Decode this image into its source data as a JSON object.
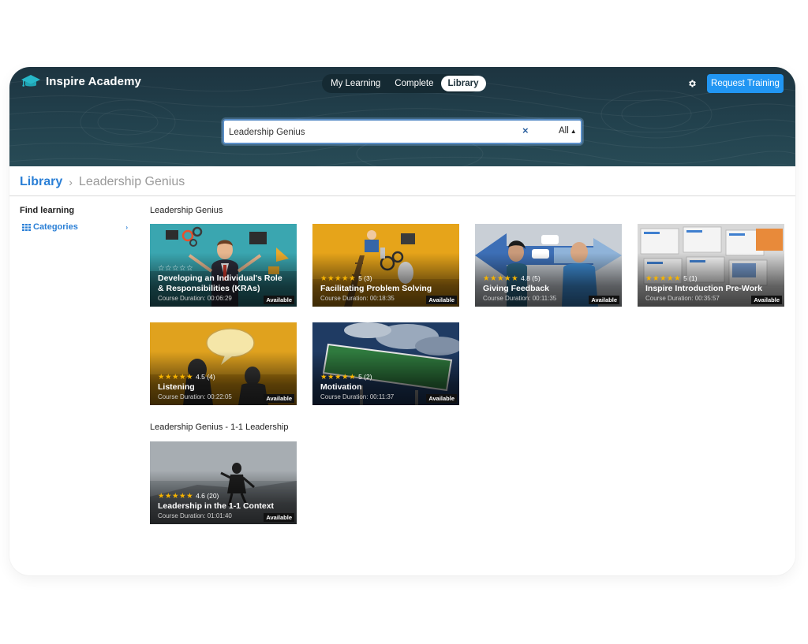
{
  "app": {
    "name": "Inspire Academy"
  },
  "nav": {
    "tabs": [
      {
        "label": "My Learning",
        "active": false
      },
      {
        "label": "Complete",
        "active": false
      },
      {
        "label": "Library",
        "active": true
      }
    ]
  },
  "header": {
    "settings_icon": "gear-icon",
    "request_label": "Request Training",
    "accent": "#2196f3"
  },
  "search": {
    "value": "Leadership Genius",
    "clear_glyph": "×",
    "filter_label": "All",
    "filter_caret": "▲"
  },
  "breadcrumb": {
    "root": "Library",
    "separator": "›",
    "current": "Leadership Genius"
  },
  "sidebar": {
    "title": "Find learning",
    "categories_label": "Categories",
    "chevron": "›"
  },
  "sections": [
    {
      "title": "Leadership Genius",
      "courses": [
        {
          "title": "Developing an Individual's Role & Responsibilities (KRAs)",
          "stars": "☆☆☆☆☆",
          "rating": "",
          "duration": "Course Duration: 00:06:29",
          "status": "Available"
        },
        {
          "title": "Facilitating Problem Solving",
          "stars": "★★★★★",
          "rating": "5 (3)",
          "duration": "Course Duration: 00:18:35",
          "status": "Available"
        },
        {
          "title": "Giving Feedback",
          "stars": "★★★★★",
          "rating": "4.8 (5)",
          "duration": "Course Duration: 00:11:35",
          "status": "Available"
        },
        {
          "title": "Inspire Introduction Pre-Work",
          "stars": "★★★★★",
          "rating": "5 (1)",
          "duration": "Course Duration: 00:35:57",
          "status": "Available"
        },
        {
          "title": "Listening",
          "stars": "★★★★★",
          "rating": "4.5 (4)",
          "duration": "Course Duration: 00:22:05",
          "status": "Available"
        },
        {
          "title": "Motivation",
          "stars": "★★★★★",
          "rating": "5 (2)",
          "duration": "Course Duration: 00:11:37",
          "status": "Available"
        }
      ]
    },
    {
      "title": "Leadership Genius - 1-1 Leadership",
      "courses": [
        {
          "title": "Leadership in the 1-1 Context",
          "stars": "★★★★★",
          "rating": "4.6 (20)",
          "duration": "Course Duration: 01:01:40",
          "status": "Available"
        }
      ]
    }
  ]
}
